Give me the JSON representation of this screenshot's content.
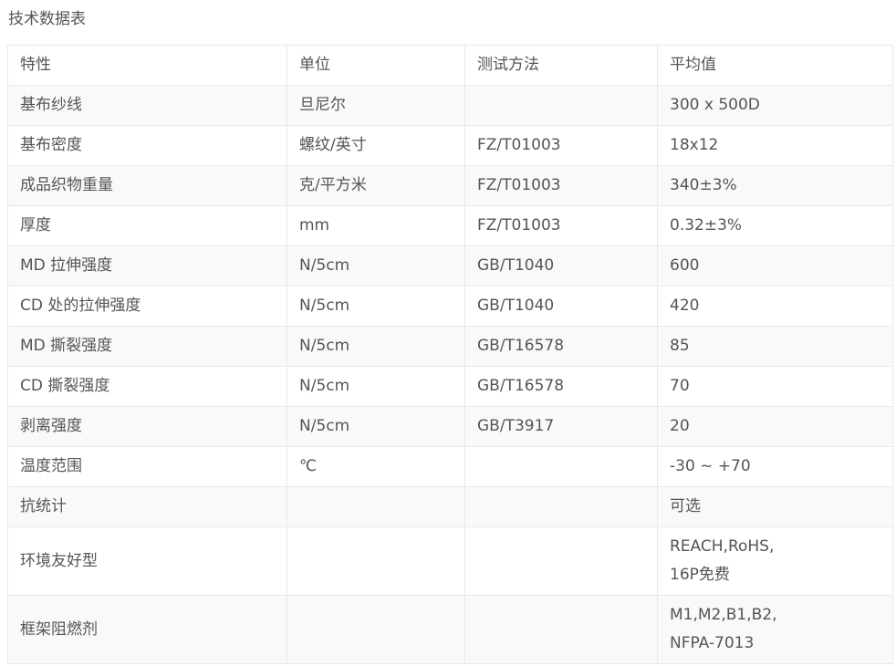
{
  "page": {
    "title": "技术数据表"
  },
  "table": {
    "headers": [
      "特性",
      "单位",
      "测试方法",
      "平均值"
    ],
    "rows": [
      {
        "property": "基布纱线",
        "unit": "旦尼尔",
        "method": "",
        "value": "300 x 500D"
      },
      {
        "property": "基布密度",
        "unit": "螺纹/英寸",
        "method": "FZ/T01003",
        "value": "18x12"
      },
      {
        "property": "成品织物重量",
        "unit": "克/平方米",
        "method": "FZ/T01003",
        "value": "340±3%"
      },
      {
        "property": "厚度",
        "unit": "mm",
        "method": "FZ/T01003",
        "value": "0.32±3%"
      },
      {
        "property": "MD 拉伸强度",
        "unit": "N/5cm",
        "method": "GB/T1040",
        "value": "600"
      },
      {
        "property": "CD 处的拉伸强度",
        "unit": "N/5cm",
        "method": "GB/T1040",
        "value": "420"
      },
      {
        "property": "MD 撕裂强度",
        "unit": "N/5cm",
        "method": "GB/T16578",
        "value": "85"
      },
      {
        "property": "CD 撕裂强度",
        "unit": "N/5cm",
        "method": "GB/T16578",
        "value": "70"
      },
      {
        "property": "剥离强度",
        "unit": "N/5cm",
        "method": "GB/T3917",
        "value": "20"
      },
      {
        "property": "温度范围",
        "unit": "℃",
        "method": "",
        "value": "-30 ~ +70"
      },
      {
        "property": "抗统计",
        "unit": "",
        "method": "",
        "value": "可选"
      },
      {
        "property": "环境友好型",
        "unit": "",
        "method": "",
        "value_lines": [
          "REACH,RoHS,",
          "16P免费"
        ]
      },
      {
        "property": "框架阻燃剂",
        "unit": "",
        "method": "",
        "value_lines": [
          "M1,M2,B1,B2,",
          "NFPA-7013"
        ]
      }
    ]
  }
}
